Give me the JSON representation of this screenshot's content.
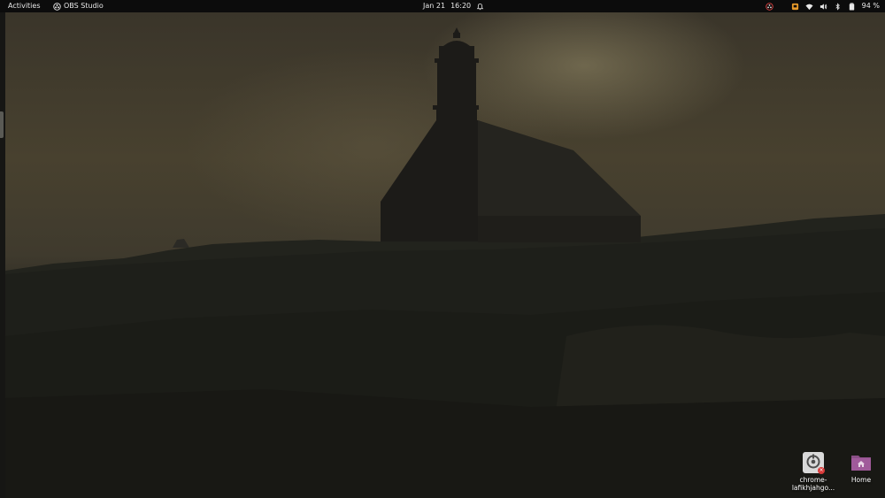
{
  "topbar": {
    "activities_label": "Activities",
    "app_name": "OBS Studio",
    "date": "Jan 21",
    "time": "16:20",
    "battery_percent": "94 %",
    "icons": [
      "obs-tray-icon",
      "notification-indicator-icon",
      "wifi-icon",
      "volume-icon",
      "bluetooth-icon",
      "battery-icon",
      "alarm-icon"
    ]
  },
  "desktop": {
    "icons": [
      {
        "label": "chrome-lafikhjahgo...",
        "icon": "chrome-app-icon"
      },
      {
        "label": "Home",
        "icon": "home-folder-icon"
      }
    ]
  },
  "colors": {
    "topbar_bg": "#0c0c0c",
    "topbar_text": "#e8e8e8",
    "folder_accent": "#a05a9a"
  }
}
